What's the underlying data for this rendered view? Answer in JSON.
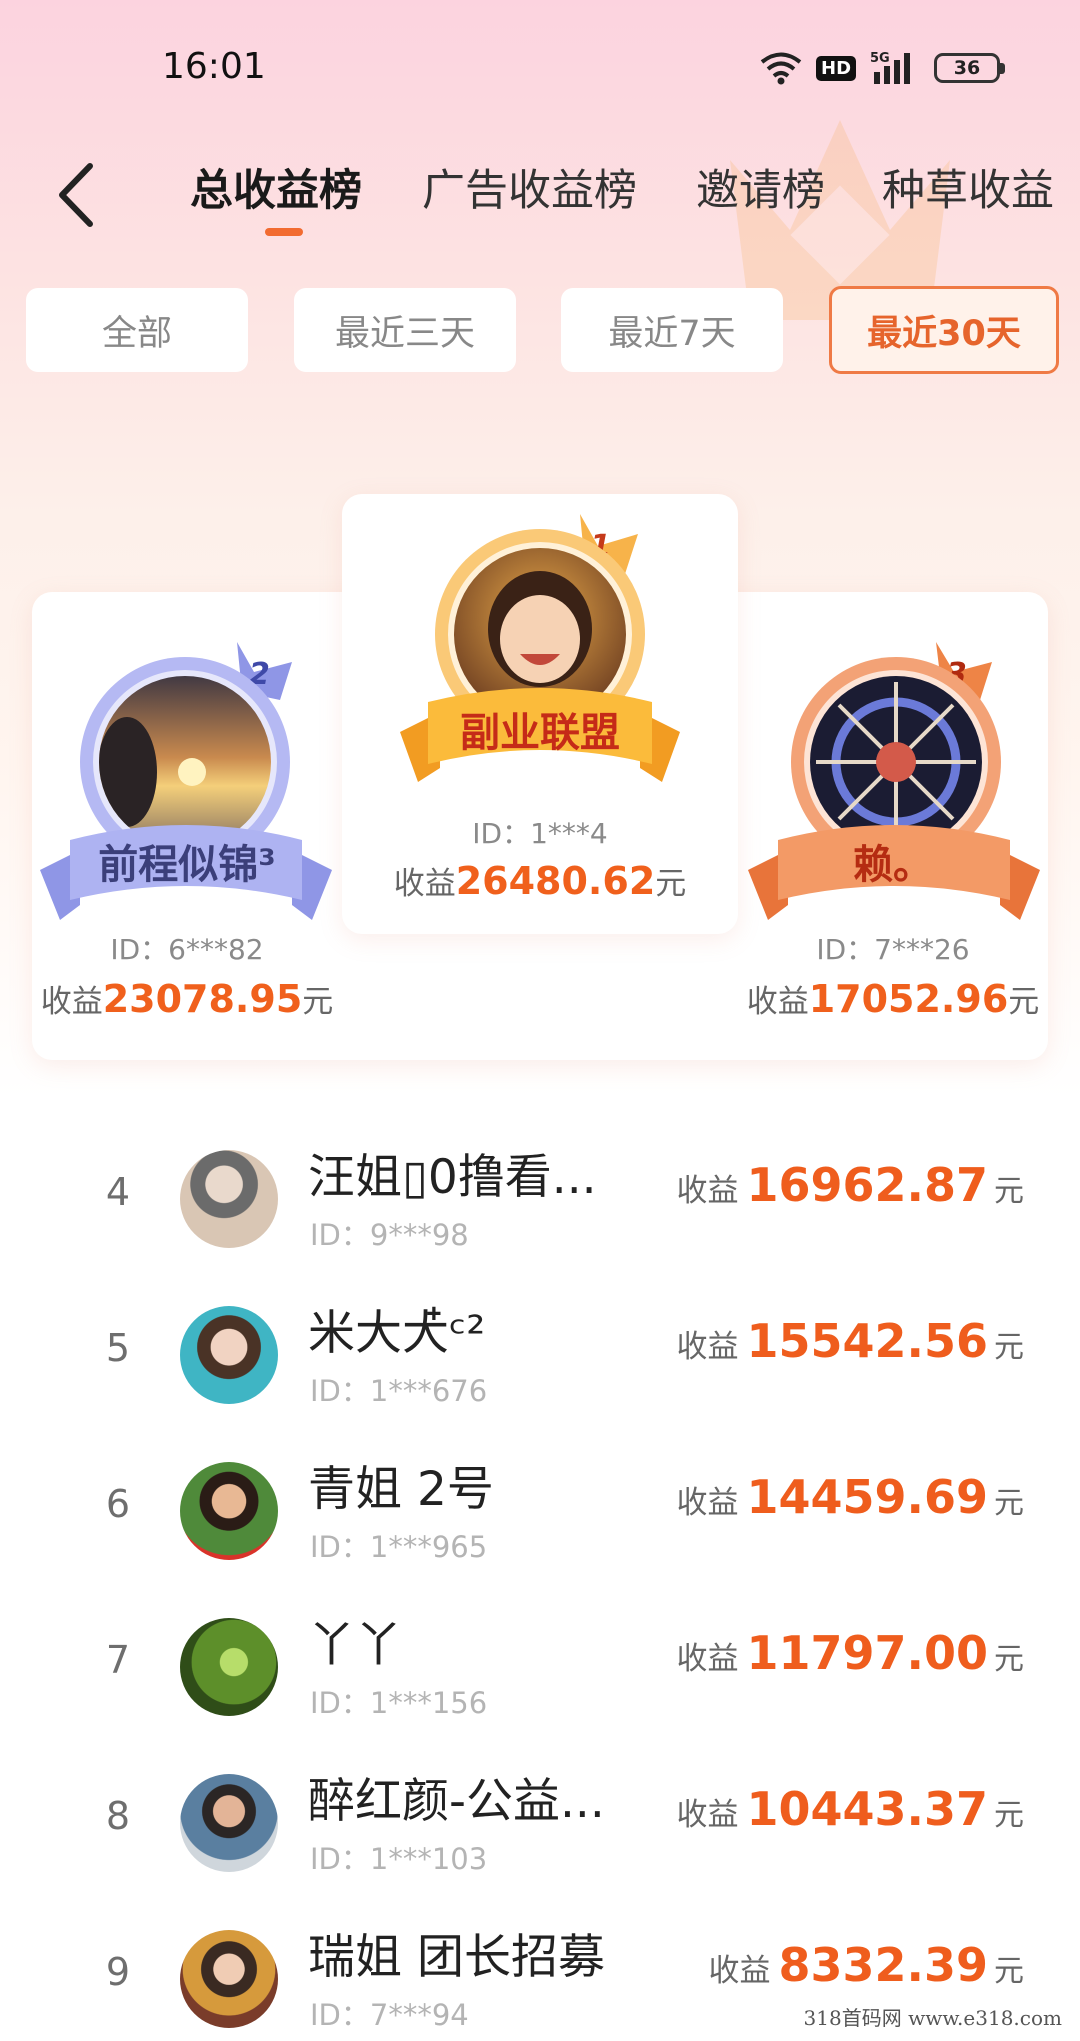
{
  "status_bar": {
    "time": "16:01",
    "hd": "HD",
    "network": "5G",
    "battery": "36"
  },
  "nav": {
    "tabs": [
      {
        "label": "总收益榜",
        "active": true
      },
      {
        "label": "广告收益榜",
        "active": false
      },
      {
        "label": "邀请榜",
        "active": false
      },
      {
        "label": "种草收益",
        "active": false
      }
    ]
  },
  "filters": [
    {
      "label": "全部",
      "active": false
    },
    {
      "label": "最近三天",
      "active": false
    },
    {
      "label": "最近7天",
      "active": false
    },
    {
      "label": "最近30天",
      "active": true
    }
  ],
  "podium": {
    "first": {
      "rank": "1",
      "name": "副业联盟",
      "id": "ID：1***4",
      "earn_label": "收益",
      "amount": "26480.62",
      "unit": "元"
    },
    "second": {
      "rank": "2",
      "name": "前程似锦³",
      "id": "ID：6***82",
      "earn_label": "收益",
      "amount": "23078.95",
      "unit": "元"
    },
    "third": {
      "rank": "3",
      "name": "赖。",
      "id": "ID：7***26",
      "earn_label": "收益",
      "amount": "17052.96",
      "unit": "元"
    }
  },
  "list": [
    {
      "rank": "4",
      "name": "汪姐▯0撸看...",
      "id": "ID：9***98",
      "earn_label": "收益",
      "amount": "16962.87",
      "unit": "元"
    },
    {
      "rank": "5",
      "name": "米大大໋ᶜ²",
      "id": "ID：1***676",
      "earn_label": "收益",
      "amount": "15542.56",
      "unit": "元"
    },
    {
      "rank": "6",
      "name": "青姐 2号",
      "id": "ID：1***965",
      "earn_label": "收益",
      "amount": "14459.69",
      "unit": "元"
    },
    {
      "rank": "7",
      "name": "丫丫",
      "id": "ID：1***156",
      "earn_label": "收益",
      "amount": "11797.00",
      "unit": "元"
    },
    {
      "rank": "8",
      "name": "醉红颜-公益...",
      "id": "ID：1***103",
      "earn_label": "收益",
      "amount": "10443.37",
      "unit": "元"
    },
    {
      "rank": "9",
      "name": "瑞姐 团长招募",
      "id": "ID：7***94",
      "earn_label": "收益",
      "amount": "8332.39",
      "unit": "元"
    }
  ],
  "watermark": "318首码网  www.e318.com",
  "colors": {
    "accent": "#f26b30",
    "amount": "#ef5d1d",
    "gold": "#f7a62a",
    "silver": "#a9aef0",
    "bronze": "#f08a55"
  }
}
